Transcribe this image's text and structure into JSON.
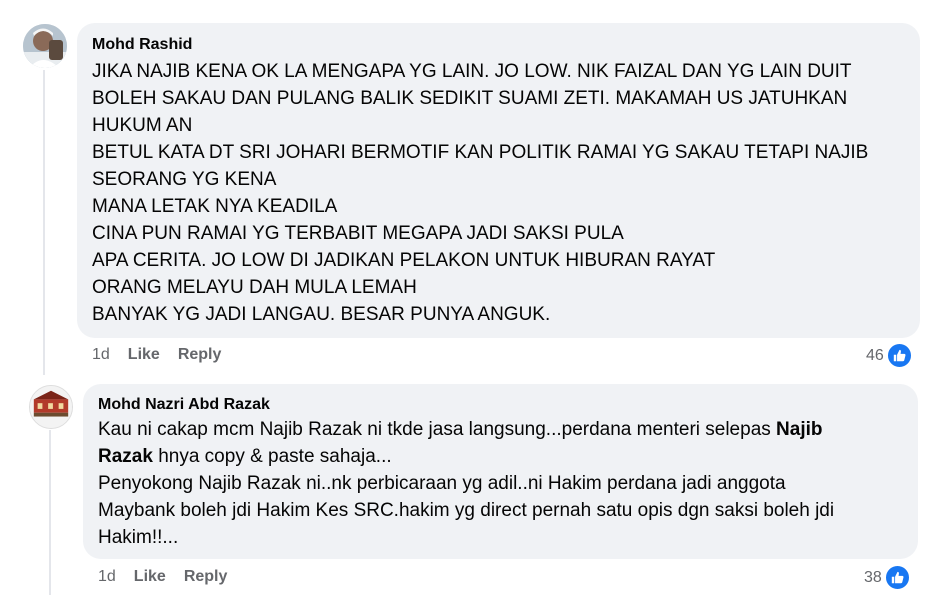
{
  "comments": [
    {
      "author": "Mohd Rashid",
      "lines": [
        "JIKA NAJIB KENA OK LA MENGAPA YG LAIN. JO LOW. NIK FAIZAL DAN YG LAIN DUIT",
        "BOLEH SAKAU DAN PULANG BALIK SEDIKIT SUAMI ZETI. MAKAMAH US JATUHKAN",
        "HUKUM AN",
        "BETUL KATA DT SRI JOHARI BERMOTIF KAN POLITIK RAMAI YG SAKAU TETAPI NAJIB",
        "SEORANG YG KENA",
        "MANA LETAK NYA KEADILA",
        "CINA PUN RAMAI YG TERBABIT MEGAPA JADI SAKSI PULA",
        "APA CERITA. JO LOW DI JADIKAN PELAKON UNTUK HIBURAN RAYAT",
        "ORANG MELAYU DAH MULA LEMAH",
        "BANYAK YG JADI LANGAU. BESAR PUNYA ANGUK."
      ],
      "time": "1d",
      "like_label": "Like",
      "reply_label": "Reply",
      "reaction_count": "46"
    },
    {
      "author": "Mohd Nazri Abd Razak",
      "line1_pre": "Kau ni cakap mcm Najib Razak ni tkde jasa langsung...perdana menteri selepas ",
      "line1_bold": "Najib",
      "line2_bold": "Razak",
      "line2_post": " hnya copy & paste sahaja...",
      "lines_rest": [
        "Penyokong Najib Razak ni..nk perbicaraan yg adil..ni Hakim perdana jadi anggota",
        "Maybank boleh jdi Hakim Kes SRC.hakim yg direct pernah satu opis dgn saksi boleh jdi",
        "Hakim!!..."
      ],
      "time": "1d",
      "like_label": "Like",
      "reply_label": "Reply",
      "reaction_count": "38"
    }
  ],
  "colors": {
    "bubble": "#f0f2f5",
    "meta": "#65676b",
    "like_blue": "#1877f2"
  }
}
